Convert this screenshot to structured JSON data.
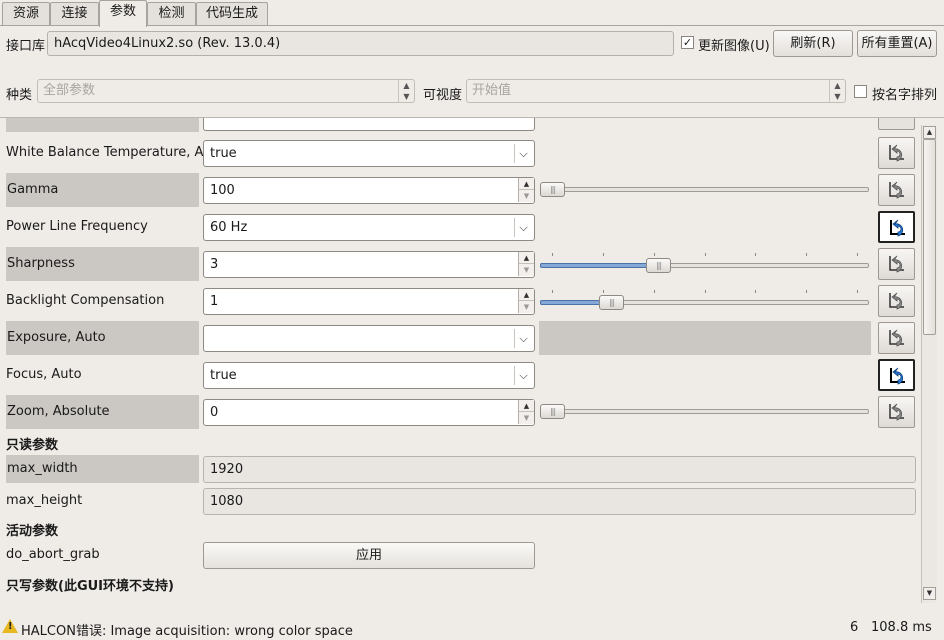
{
  "tabs": [
    "资源",
    "连接",
    "参数",
    "检测",
    "代码生成"
  ],
  "active_tab": "参数",
  "interface": {
    "label": "接口库",
    "value": "hAcqVideo4Linux2.so (Rev. 13.0.4)",
    "update_image_label": "更新图像(U)",
    "update_image_checked": true,
    "refresh_label": "刷新(R)",
    "reset_all_label": "所有重置(A)"
  },
  "filter": {
    "category_label": "种类",
    "category_value": "全部参数",
    "visibility_label": "可视度",
    "visibility_value": "开始值",
    "sort_label": "按名字排列",
    "sort_checked": false
  },
  "params": [
    {
      "name": "White Balance Temperature, Auto",
      "kind": "combo",
      "value": "true"
    },
    {
      "name": "Gamma",
      "kind": "spin",
      "value": "100",
      "slider_fraction": 0.0
    },
    {
      "name": "Power Line Frequency",
      "kind": "combo",
      "value": "60 Hz"
    },
    {
      "name": "Sharpness",
      "kind": "spin",
      "value": "3",
      "slider_fraction": 0.35
    },
    {
      "name": "Backlight Compensation",
      "kind": "spin",
      "value": "1",
      "slider_fraction": 0.195
    },
    {
      "name": "Exposure, Auto",
      "kind": "combo",
      "value": ""
    },
    {
      "name": "Focus, Auto",
      "kind": "combo",
      "value": "true"
    },
    {
      "name": "Zoom, Absolute",
      "kind": "spin",
      "value": "0",
      "slider_fraction": 0.0
    }
  ],
  "readonly_section": {
    "title": "只读参数",
    "items": [
      {
        "name": "max_width",
        "value": "1920"
      },
      {
        "name": "max_height",
        "value": "1080"
      }
    ]
  },
  "action_section": {
    "title": "活动参数",
    "items": [
      {
        "name": "do_abort_grab",
        "button": "应用"
      }
    ]
  },
  "writeonly_section": {
    "title": "只写参数(此GUI环境不支持)"
  },
  "status": {
    "message": "HALCON错误: Image acquisition: wrong color space",
    "count": "6",
    "time": "108.8 ms"
  }
}
